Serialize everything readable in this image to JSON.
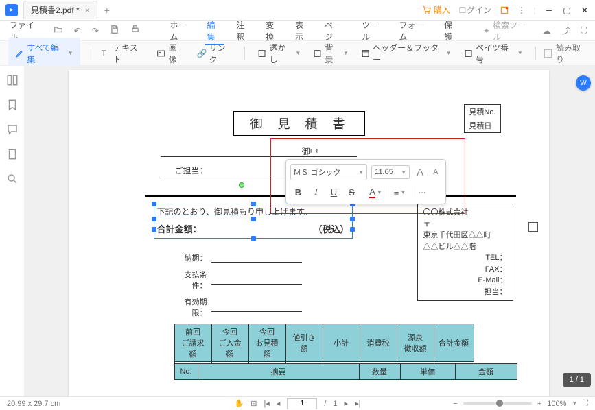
{
  "titlebar": {
    "tab_name": "見積書2.pdf *",
    "buy": "購入",
    "login": "ログイン"
  },
  "menubar": {
    "file": "ファイル",
    "items": [
      "ホーム",
      "編集",
      "注釈",
      "変換",
      "表示",
      "ページ",
      "ツール",
      "フォーム",
      "保護"
    ],
    "search": "検索ツール"
  },
  "toolbar": {
    "edit_all": "すべて編集",
    "text": "テキスト",
    "image": "画像",
    "link": "リンク",
    "watermark": "透かし",
    "background": "背景",
    "header_footer": "ヘッダー＆フッター",
    "bates": "ベイツ番号",
    "readonly": "読み取り"
  },
  "doc": {
    "title": "御見積書",
    "est_no": "見積No.",
    "est_date": "見積日",
    "onchu": "御中",
    "tantou": "ご担当：",
    "sel_text": "下記のとおり、御見積もり申し上げます。",
    "goukei": "合計金額：",
    "zeikomi": "（税込）",
    "terms": {
      "label1": "納期：",
      "label2": "支払条件：",
      "label3": "有効期限："
    },
    "company": {
      "name": "〇〇株式会社",
      "post": "〒",
      "addr1": "東京千代田区△△町",
      "addr2": "△△ビル△△階",
      "tel": "TEL：",
      "fax": "FAX：",
      "email": "E-Mail：",
      "tantou": "担当："
    },
    "tbl1": [
      "前回\nご請求額",
      "今回\nご入金額",
      "今回\nお見積額",
      "値引き額",
      "小計",
      "消費税",
      "源泉\n徴収額",
      "合計金額"
    ],
    "tbl2": [
      "No.",
      "摘要",
      "数量",
      "単価",
      "金額"
    ]
  },
  "float": {
    "font": "ＭＳ ゴシック",
    "size": "11.05",
    "bigA": "A",
    "smallA": "A",
    "b": "B",
    "i": "I",
    "u": "U",
    "s": "S",
    "color": "A",
    "align": "≡"
  },
  "status": {
    "dims": "20.99 x 29.7 cm",
    "page_cur": "1",
    "page_sep": "/",
    "page_tot": "1",
    "page_ind": "1 / 1",
    "zoom": "100%"
  }
}
